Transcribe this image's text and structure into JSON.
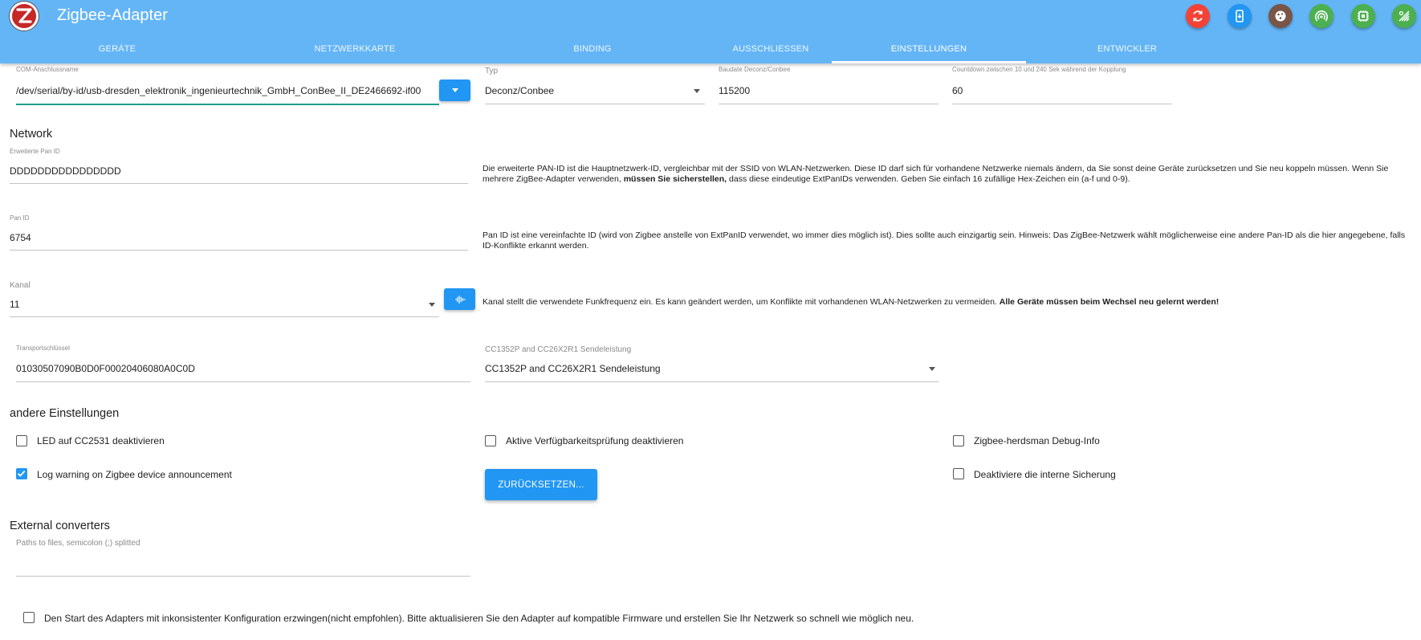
{
  "header": {
    "title": "Zigbee-Adapter",
    "logo_letter": "Z",
    "buttons": [
      {
        "name": "refresh-icon",
        "color": "#f44336"
      },
      {
        "name": "phone-icon",
        "color": "#2196f3"
      },
      {
        "name": "cookie-icon",
        "color": "#795548"
      },
      {
        "name": "signal-icon",
        "color": "#4caf50"
      },
      {
        "name": "chip-icon",
        "color": "#4caf50"
      },
      {
        "name": "wifi-settings-icon",
        "color": "#4caf50"
      }
    ]
  },
  "tabs": [
    "GERÄTE",
    "NETZWERKKARTE",
    "BINDING",
    "AUSSCHLIESSEN",
    "EINSTELLUNGEN",
    "ENTWICKLER"
  ],
  "active_tab": "EINSTELLUNGEN",
  "com": {
    "label": "COM-Anschlussname",
    "value": "/dev/serial/by-id/usb-dresden_elektronik_ingenieurtechnik_GmbH_ConBee_II_DE2466692-if00"
  },
  "typ": {
    "label": "Typ",
    "value": "Deconz/Conbee"
  },
  "baudrate": {
    "label": "Baudate Deconz/Conbee",
    "value": "115200"
  },
  "countdown": {
    "label": "Countdown zwischen 10 und 240 Sek während der Kopplung",
    "value": "60"
  },
  "network": {
    "title": "Network",
    "ext_pan": {
      "label": "Erweiterte Pan ID",
      "value": "DDDDDDDDDDDDDDDD"
    },
    "ext_pan_desc_1": "Die erweiterte PAN-ID ist die Hauptnetzwerk-ID, vergleichbar mit der SSID von WLAN-Netzwerken. Diese ID darf sich für vorhandene Netzwerke niemals ändern, da Sie sonst deine Geräte zurücksetzen und Sie neu koppeln müssen. Wenn Sie mehrere ZigBee-Adapter verwenden, ",
    "ext_pan_desc_bold": "müssen Sie sicherstellen,",
    "ext_pan_desc_2": " dass diese eindeutige ExtPanIDs verwenden. Geben Sie einfach 16 zufällige Hex-Zeichen ein (a-f und 0-9).",
    "pan": {
      "label": "Pan ID",
      "value": "6754"
    },
    "pan_desc": "Pan ID ist eine vereinfachte ID (wird von Zigbee anstelle von ExtPanID verwendet, wo immer dies möglich ist). Dies sollte auch einzigartig sein. Hinweis: Das ZigBee-Netzwerk wählt möglicherweise eine andere Pan-ID als die hier angegebene, falls ID-Konflikte erkannt werden.",
    "kanal": {
      "label": "Kanal",
      "value": "11"
    },
    "kanal_desc": "Kanal stellt die verwendete Funkfrequenz ein. Es kann geändert werden, um Konflikte mit vorhandenen WLAN-Netzwerken zu vermeiden. ",
    "kanal_desc_bold": "Alle Geräte müssen beim Wechsel neu gelernt werden!",
    "transport": {
      "label": "Transportschlüssel",
      "value": "01030507090B0D0F00020406080A0C0D"
    },
    "power": {
      "label": "CC1352P and CC26X2R1 Sendeleistung",
      "value": "CC1352P and CC26X2R1 Sendeleistung"
    }
  },
  "other": {
    "title": "andere Einstellungen",
    "checkboxes": [
      {
        "label": "LED auf CC2531 deaktivieren",
        "checked": false
      },
      {
        "label": "Aktive Verfügbarkeitsprüfung deaktivieren",
        "checked": false
      },
      {
        "label": "Zigbee-herdsman Debug-Info",
        "checked": false
      },
      {
        "label": "Log warning on Zigbee device announcement",
        "checked": true
      },
      {
        "label": "Deaktiviere die interne Sicherung",
        "checked": false
      }
    ],
    "reset_label": "ZURÜCKSETZEN..."
  },
  "external": {
    "title": "External converters",
    "label": "Paths to files, semicolon (;) splitted",
    "value": ""
  },
  "force_start": {
    "label": "Den Start des Adapters mit inkonsistenter Konfiguration erzwingen(nicht empfohlen). Bitte aktualisieren Sie den Adapter auf kompatible Firmware und erstellen Sie Ihr Netzwerk so schnell wie möglich neu.",
    "checked": false
  }
}
